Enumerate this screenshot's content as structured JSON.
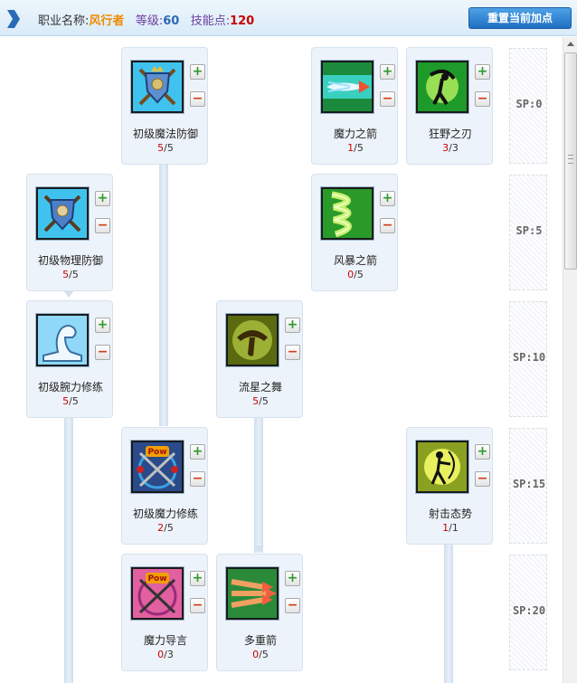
{
  "header": {
    "job_label": "职业名称:",
    "job_value": "风行者",
    "level_label": "等级:",
    "level_value": "60",
    "sp_label": "技能点:",
    "sp_value": "120",
    "reset_button": "重置当前加点"
  },
  "skills": [
    {
      "id": "novice-magic-defense",
      "name": "初级魔法防御",
      "current": "5",
      "max": "5",
      "icon": "shield-magic-icon"
    },
    {
      "id": "magic-arrow",
      "name": "魔力之箭",
      "current": "1",
      "max": "5",
      "icon": "magic-arrow-icon"
    },
    {
      "id": "wild-blade",
      "name": "狂野之刃",
      "current": "3",
      "max": "3",
      "icon": "wild-blade-icon"
    },
    {
      "id": "novice-physical-defense",
      "name": "初级物理防御",
      "current": "5",
      "max": "5",
      "icon": "shield-physical-icon"
    },
    {
      "id": "storm-arrow",
      "name": "风暴之箭",
      "current": "0",
      "max": "5",
      "icon": "storm-arrow-icon"
    },
    {
      "id": "novice-arm-training",
      "name": "初级腕力修练",
      "current": "5",
      "max": "5",
      "icon": "arm-icon"
    },
    {
      "id": "meteor-dance",
      "name": "流星之舞",
      "current": "5",
      "max": "5",
      "icon": "boomerang-icon"
    },
    {
      "id": "novice-magic-training",
      "name": "初级魔力修练",
      "current": "2",
      "max": "5",
      "icon": "pow-swords-blue-icon"
    },
    {
      "id": "shooting-stance",
      "name": "射击态势",
      "current": "1",
      "max": "1",
      "icon": "archer-icon"
    },
    {
      "id": "magic-incantation",
      "name": "魔力导言",
      "current": "0",
      "max": "3",
      "icon": "pow-swords-pink-icon"
    },
    {
      "id": "multi-arrow",
      "name": "多重箭",
      "current": "0",
      "max": "5",
      "icon": "multi-arrow-icon"
    }
  ],
  "sp_tiers": [
    "SP:0",
    "SP:5",
    "SP:10",
    "SP:15",
    "SP:20"
  ],
  "colors": {
    "header_bg": "#d9ebf8",
    "job_name": "#f08a00",
    "level": "#2a6bb5",
    "skill_points": "#c80000",
    "reset_button": "#1f6fc1",
    "card_bg": "#edf3fa",
    "plus": "#2e9a2e",
    "minus": "#d03a1a"
  }
}
